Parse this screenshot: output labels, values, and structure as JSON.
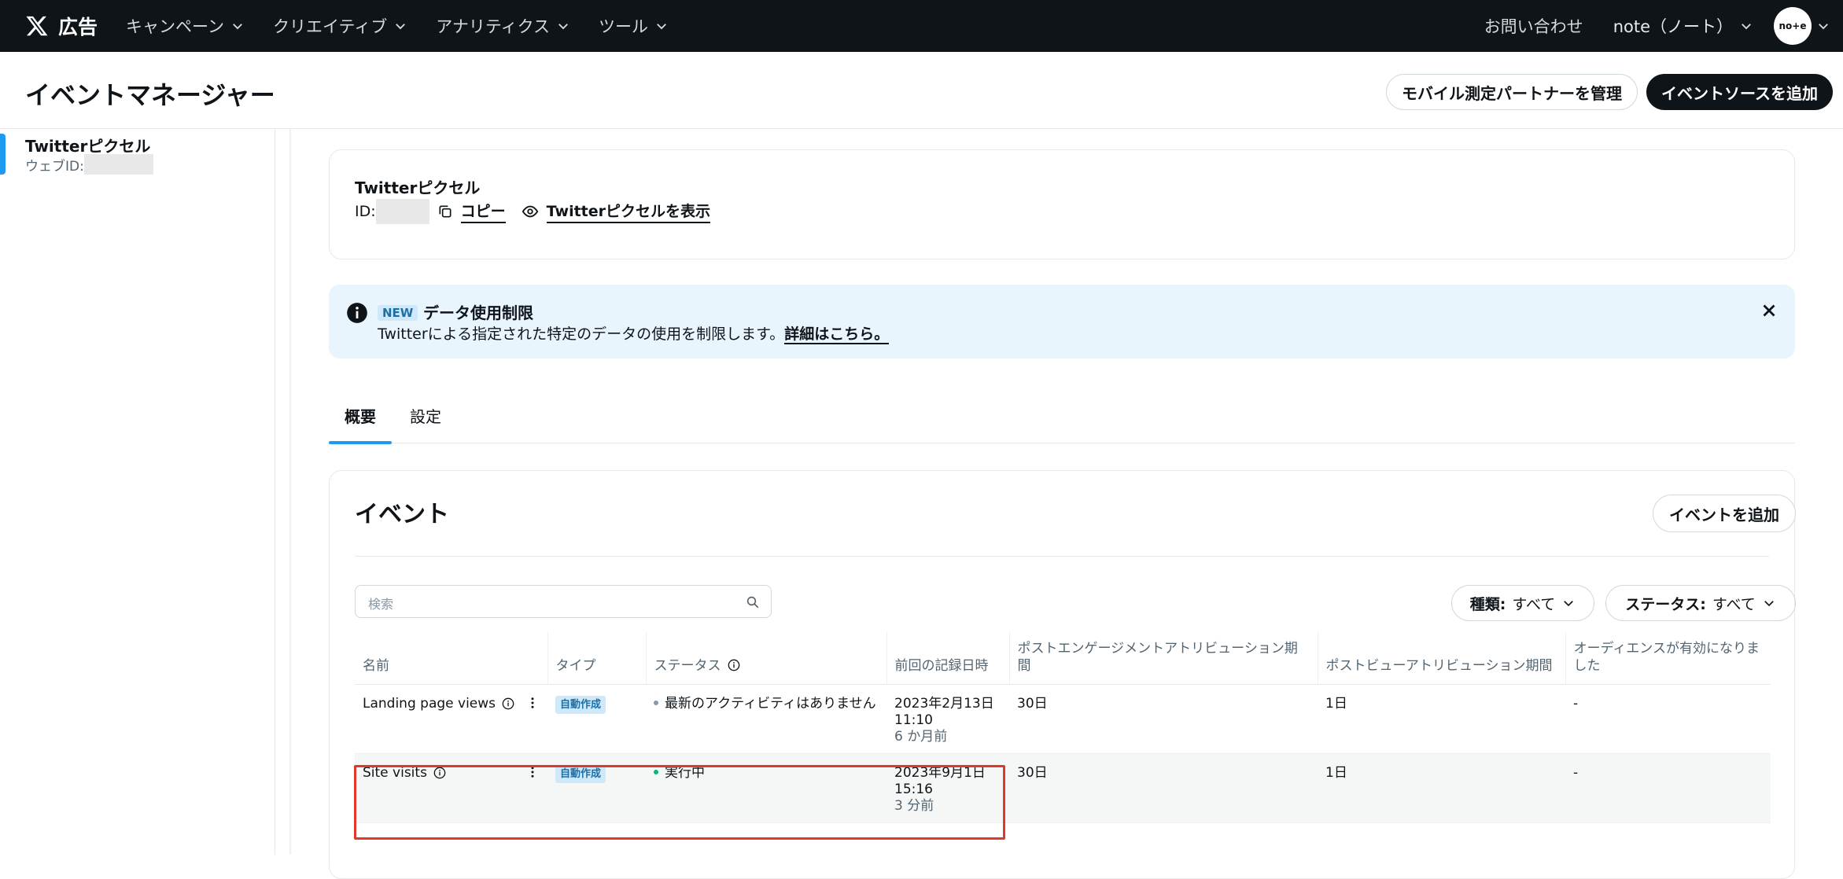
{
  "topbar": {
    "brand_label": "広告",
    "nav": [
      "キャンペーン",
      "クリエイティブ",
      "アナリティクス",
      "ツール"
    ],
    "contact": "お問い合わせ",
    "account": "note（ノート）",
    "avatar_text": "no+e"
  },
  "header": {
    "title": "イベントマネージャー",
    "mobile_partner_button": "モバイル測定パートナーを管理",
    "add_source_button": "イベントソースを追加"
  },
  "sidebar": {
    "item_title": "Twitterピクセル",
    "item_sub": "ウェブID:"
  },
  "pixel_card": {
    "title": "Twitterピクセル",
    "id_label": "ID:",
    "copy": "コピー",
    "view": "Twitterピクセルを表示"
  },
  "notice": {
    "badge": "NEW",
    "title": "データ使用制限",
    "body": "Twitterによる指定された特定のデータの使用を制限します。",
    "link": "詳細はこちら。"
  },
  "tabs": [
    "概要",
    "設定"
  ],
  "events": {
    "title": "イベント",
    "add_button": "イベントを追加",
    "search_placeholder": "検索",
    "filter_type_label": "種類:",
    "filter_type_value": "すべて",
    "filter_status_label": "ステータス:",
    "filter_status_value": "すべて",
    "columns": [
      "名前",
      "タイプ",
      "ステータス",
      "前回の記録日時",
      "ポストエンゲージメントアトリビューション期間",
      "ポストビューアトリビューション期間",
      "オーディエンスが有効になりました"
    ],
    "rows": [
      {
        "name": "Landing page views",
        "type": "自動作成",
        "status": "最新のアクティビティはありません",
        "date": "2023年2月13日",
        "time": "11:10",
        "ago": "6 か月前",
        "engagement": "30日",
        "view": "1日",
        "audience": "-"
      },
      {
        "name": "Site visits",
        "type": "自動作成",
        "status": "実行中",
        "date": "2023年9月1日",
        "time": "15:16",
        "ago": "3 分前",
        "engagement": "30日",
        "view": "1日",
        "audience": "-"
      }
    ]
  },
  "colors": {
    "accent": "#1d9bf0",
    "dark": "#0f1419",
    "active_status": "#00ba7c",
    "inactive_status": "#8b98a5",
    "highlight": "#e0392b"
  }
}
